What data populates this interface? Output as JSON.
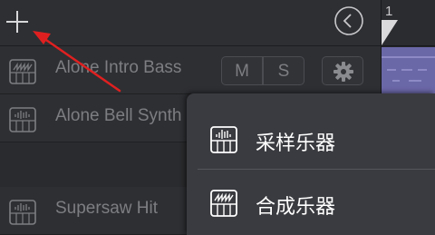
{
  "header": {
    "add_icon": "plus-icon",
    "collapse_icon": "chevron-left-circle-icon"
  },
  "timeline": {
    "bar_number": "1",
    "region_color": "#6b68a8"
  },
  "tracks": [
    {
      "name": "Alone Intro Bass",
      "icon": "synth-keyboard-icon",
      "mute_label": "M",
      "solo_label": "S"
    },
    {
      "name": "Alone Bell Synth",
      "icon": "sampler-keyboard-icon"
    },
    {
      "name": "Supersaw Hit",
      "icon": "sampler-keyboard-icon"
    }
  ],
  "menu": {
    "items": [
      {
        "label": "采样乐器",
        "icon": "sampler-keyboard-icon"
      },
      {
        "label": "合成乐器",
        "icon": "synth-keyboard-icon"
      }
    ]
  },
  "annotation": {
    "arrow_color": "#e02020"
  }
}
